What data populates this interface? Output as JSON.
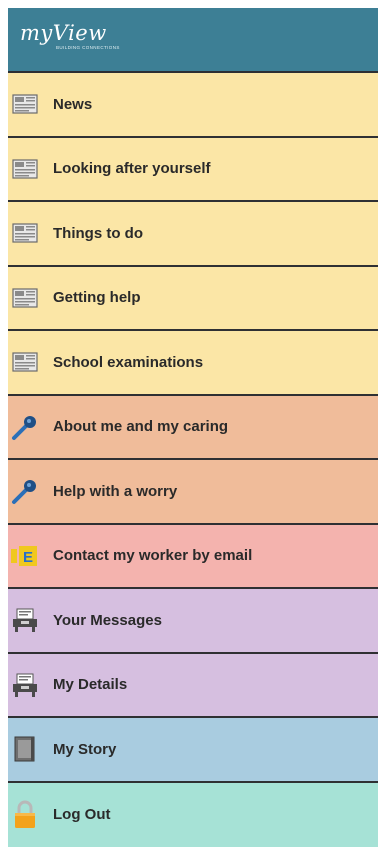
{
  "header": {
    "logo_text": "myView",
    "logo_tagline": "BUILDING CONNECTIONS"
  },
  "colors": {
    "header": "#3d7f95",
    "yellow": "#fbe6a6",
    "orange": "#f0bc9a",
    "pink": "#f4b3ae",
    "purple": "#d6bfe0",
    "blue": "#a9cce0",
    "teal": "#a6e2d6"
  },
  "menu": {
    "items": [
      {
        "label": "News",
        "icon": "newspaper-icon"
      },
      {
        "label": "Looking after yourself",
        "icon": "newspaper-icon"
      },
      {
        "label": "Things to do",
        "icon": "newspaper-icon"
      },
      {
        "label": "Getting help",
        "icon": "newspaper-icon"
      },
      {
        "label": "School examinations",
        "icon": "newspaper-icon"
      },
      {
        "label": "About me and my caring",
        "icon": "microphone-icon"
      },
      {
        "label": "Help with a worry",
        "icon": "microphone-icon"
      },
      {
        "label": "Contact my worker by email",
        "icon": "email-icon"
      },
      {
        "label": "Your Messages",
        "icon": "inbox-icon"
      },
      {
        "label": "My Details",
        "icon": "inbox-icon"
      },
      {
        "label": "My Story",
        "icon": "notebook-icon"
      },
      {
        "label": "Log Out",
        "icon": "padlock-icon"
      }
    ]
  }
}
